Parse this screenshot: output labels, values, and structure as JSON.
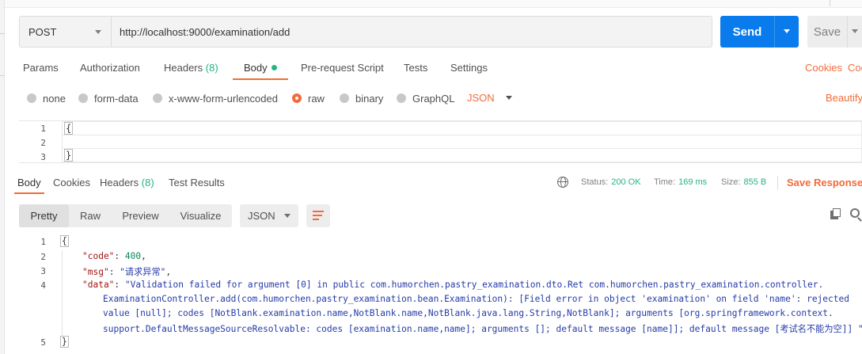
{
  "request": {
    "method": "POST",
    "url": "http://localhost:9000/examination/add",
    "send_label": "Send",
    "save_label": "Save"
  },
  "request_tabs": {
    "params": "Params",
    "authorization": "Authorization",
    "headers": "Headers",
    "headers_count": "(8)",
    "body": "Body",
    "prerequest": "Pre-request Script",
    "tests": "Tests",
    "settings": "Settings",
    "cookies": "Cookies",
    "code": "Coc"
  },
  "body_types": {
    "none": "none",
    "form_data": "form-data",
    "urlencoded": "x-www-form-urlencoded",
    "raw": "raw",
    "binary": "binary",
    "graphql": "GraphQL",
    "language": "JSON",
    "beautify": "Beautify",
    "selected": "raw"
  },
  "request_editor": {
    "line_numbers": [
      "1",
      "2",
      "3"
    ],
    "lines": [
      "{",
      "",
      "}"
    ]
  },
  "response_tabs": {
    "body": "Body",
    "cookies": "Cookies",
    "headers": "Headers",
    "headers_count": "(8)",
    "test_results": "Test Results"
  },
  "response_status": {
    "status_label": "Status:",
    "status_value": "200 OK",
    "time_label": "Time:",
    "time_value": "169 ms",
    "size_label": "Size:",
    "size_value": "855 B",
    "save_response": "Save Response"
  },
  "response_toolbar": {
    "pretty": "Pretty",
    "raw": "Raw",
    "preview": "Preview",
    "visualize": "Visualize",
    "language": "JSON"
  },
  "response_code": {
    "line_numbers": [
      "1",
      "2",
      "3",
      "4",
      "5"
    ],
    "open_brace": "{",
    "close_brace": "}",
    "code_key": "\"code\"",
    "code_value": "400",
    "msg_key": "\"msg\"",
    "msg_value": "\"请求异常\"",
    "data_key": "\"data\"",
    "data_value_line1": "\"Validation failed for argument [0] in public com.humorchen.pastry_examination.dto.Ret com.humorchen.pastry_examination.controller.",
    "data_value_line2": "ExaminationController.add(com.humorchen.pastry_examination.bean.Examination): [Field error in object 'examination' on field 'name': rejected",
    "data_value_line3": "value [null]; codes [NotBlank.examination.name,NotBlank.name,NotBlank.java.lang.String,NotBlank]; arguments [org.springframework.context.",
    "data_value_line4": "support.DefaultMessageSourceResolvable: codes [examination.name,name]; arguments []; default message [name]]; default message [考试名不能为空]] \""
  },
  "colors": {
    "accent": "#f26b3a",
    "send_blue": "#097bed",
    "success_green": "#26b47f"
  }
}
